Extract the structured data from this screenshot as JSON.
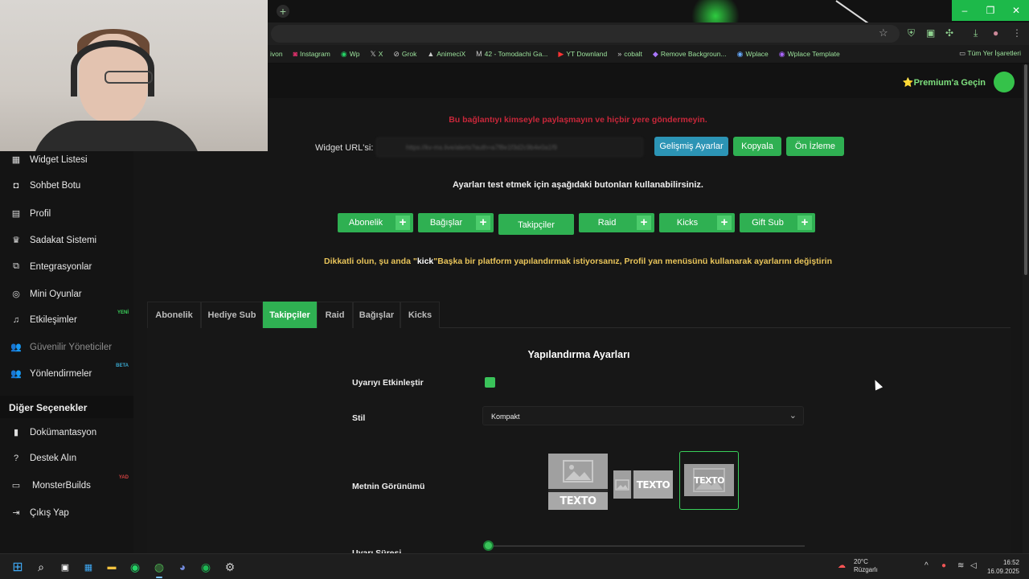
{
  "bookmarks": {
    "items": [
      {
        "label": "ivon",
        "icon": "bookmark-icon"
      },
      {
        "label": "Instagram",
        "icon": "instagram-icon"
      },
      {
        "label": "Wp",
        "icon": "whatsapp-icon"
      },
      {
        "label": "X",
        "icon": "x-icon"
      },
      {
        "label": "Grok",
        "icon": "grok-icon"
      },
      {
        "label": "AnimeciX",
        "icon": "animecix-icon"
      },
      {
        "label": "42 - Tomodachi Ga...",
        "icon": "gmail-icon"
      },
      {
        "label": "YT Downland",
        "icon": "youtube-icon"
      },
      {
        "label": "cobalt",
        "icon": "cobalt-icon"
      },
      {
        "label": "Remove Backgroun...",
        "icon": "remove-bg-icon"
      },
      {
        "label": "Wplace",
        "icon": "wplace-icon"
      },
      {
        "label": "Wplace Template",
        "icon": "wplace-template-icon"
      }
    ],
    "all_bookmarks": "Tüm Yer İşaretleri"
  },
  "header": {
    "premium": "⭐Premium'a Geçin"
  },
  "sidebar": {
    "items": [
      {
        "label": "Widget Listesi",
        "icon": "grid-icon"
      },
      {
        "label": "Sohbet Botu",
        "icon": "robot-icon"
      },
      {
        "label": "Profil",
        "icon": "id-card-icon"
      },
      {
        "label": "Sadakat Sistemi",
        "icon": "trophy-icon"
      },
      {
        "label": "Entegrasyonlar",
        "icon": "link-icon"
      },
      {
        "label": "Mini Oyunlar",
        "icon": "gamepad-icon"
      },
      {
        "label": "Etkileşimler",
        "icon": "music-note-icon",
        "badge": "YENİ"
      },
      {
        "label": "Güvenilir Yöneticiler",
        "icon": "users-icon"
      },
      {
        "label": "Yönlendirmeler",
        "icon": "users-icon",
        "badge": "BETA"
      }
    ],
    "section_title": "Diğer Seçenekler",
    "other_items": [
      {
        "label": "Dokümantasyon",
        "icon": "book-icon"
      },
      {
        "label": "Destek Alın",
        "icon": "question-icon"
      },
      {
        "label": "MonsterBuilds",
        "icon": "laptop-icon",
        "badge": "YAD"
      },
      {
        "label": "Çıkış Yap",
        "icon": "logout-icon"
      }
    ],
    "badge_colors": {
      "new": "#3ad05a",
      "beta": "#3aa9d0",
      "ad": "#d04040"
    }
  },
  "widget": {
    "warning": "Bu bağlantıyı kimseyle paylaşmayın ve hiçbir yere göndermeyin.",
    "url_label": "Widget URL'si:",
    "url_value": "https://kv-ms.live/alerts?auth=a7f8e1f3d2c9b4e0a1f9",
    "advanced_button": "Gelişmiş Ayarlar",
    "copy_button": "Kopyala",
    "preview_button": "Ön İzleme",
    "test_instructions": "Ayarları test etmek için aşağıdaki butonları kullanabilirsiniz.",
    "test_buttons": [
      "Abonelik",
      "Bağışlar",
      "Takipçiler",
      "Raid",
      "Kicks",
      "Gift Sub"
    ],
    "caution_pre": "Dikkatli olun, şu anda \"",
    "caution_platform": "kick",
    "caution_post": "\"Başka bir platform yapılandırmak istiyorsanız, Profil yan menüsünü kullanarak ayarlarını değiştirin"
  },
  "tabs": [
    "Abonelik",
    "Hediye Sub",
    "Takipçiler",
    "Raid",
    "Bağışlar",
    "Kicks"
  ],
  "config": {
    "title": "Yapılandırma Ayarları",
    "enable_label": "Uyarıyı Etkinleştir",
    "enabled": true,
    "style_label": "Stil",
    "style_value": "Kompakt",
    "text_view_label": "Metnin Görünümü",
    "text_sample": "TEXTO",
    "duration_label": "Uyarı Süresi",
    "duration_level": 0.0
  },
  "taskbar": {
    "weather_temp": "20°C",
    "weather_desc": "Rüzgarlı",
    "time": "16:52",
    "date": "16.09.2025"
  },
  "colors": {
    "accent": "#2fb052",
    "blue": "#2c94b5",
    "warning_red": "#c8273a",
    "caution_yellow": "#e8c45a"
  }
}
